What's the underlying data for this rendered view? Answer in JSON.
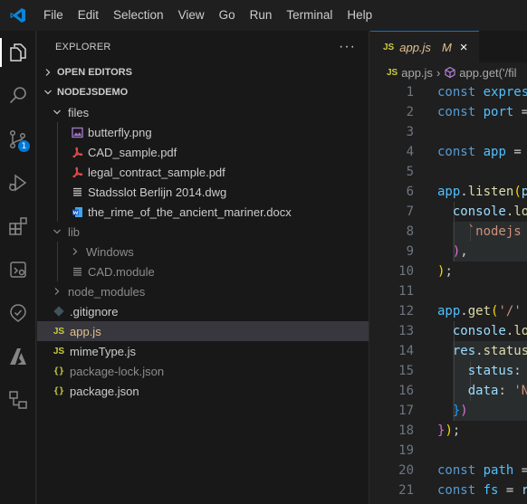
{
  "menu": [
    "File",
    "Edit",
    "Selection",
    "View",
    "Go",
    "Run",
    "Terminal",
    "Help"
  ],
  "activity": {
    "scm_badge": "1"
  },
  "explorer": {
    "title": "EXPLORER",
    "more": "···",
    "open_editors": "OPEN EDITORS",
    "project": "NODEJSDEMO",
    "items": [
      {
        "label": "files"
      },
      {
        "label": "butterfly.png"
      },
      {
        "label": "CAD_sample.pdf"
      },
      {
        "label": "legal_contract_sample.pdf"
      },
      {
        "label": "Stadsslot Berlijn 2014.dwg"
      },
      {
        "label": "the_rime_of_the_ancient_mariner.docx"
      },
      {
        "label": "lib"
      },
      {
        "label": "Windows"
      },
      {
        "label": "CAD.module"
      },
      {
        "label": "node_modules"
      },
      {
        "label": ".gitignore"
      },
      {
        "label": "app.js"
      },
      {
        "label": "mimeType.js"
      },
      {
        "label": "package-lock.json"
      },
      {
        "label": "package.json"
      }
    ]
  },
  "editor": {
    "tab": {
      "lang": "JS",
      "name": "app.js",
      "status": "M",
      "close": "×"
    },
    "breadcrumb": {
      "file": "app.js",
      "sep": "›",
      "symbol": "app.get('/fil"
    },
    "line_numbers": [
      "1",
      "2",
      "3",
      "4",
      "5",
      "6",
      "7",
      "8",
      "9",
      "10",
      "11",
      "12",
      "13",
      "14",
      "15",
      "16",
      "17",
      "18",
      "19",
      "20",
      "21"
    ]
  },
  "colors": {
    "accent": "#0078d4",
    "selection": "#37373d",
    "modified": "#e2c08d"
  }
}
